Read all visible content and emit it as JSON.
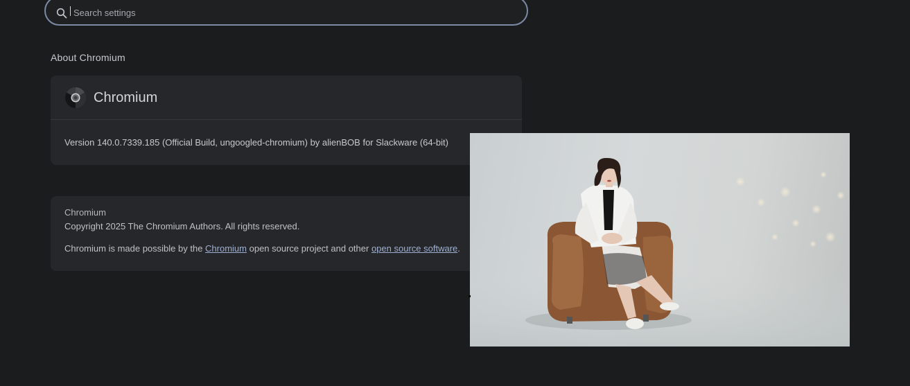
{
  "search": {
    "placeholder": "Search settings",
    "value": ""
  },
  "about": {
    "section_title": "About Chromium",
    "product_name": "Chromium",
    "version": "Version 140.0.7339.185 (Official Build, ungoogled-chromium) by alienBOB for Slackware (64-bit)"
  },
  "legal": {
    "product": "Chromium",
    "copyright": "Copyright 2025 The Chromium Authors. All rights reserved.",
    "credits_prefix": "Chromium is made possible by the ",
    "credits_link1": "Chromium",
    "credits_middle": " open source project and other ",
    "credits_link2": "open source software",
    "credits_suffix": "."
  },
  "icons": {
    "search": "search-icon",
    "logo": "chromium-logo-icon"
  },
  "colors": {
    "background": "#1b1c1e",
    "card": "#26272a",
    "search_border": "#7c8aa6",
    "link": "#9fb0d2"
  }
}
